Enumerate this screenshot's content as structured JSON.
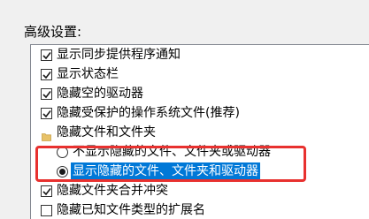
{
  "advanced": {
    "title": "高级设置:",
    "items": [
      {
        "kind": "checkbox",
        "label": "显示同步提供程序通知",
        "checked": true
      },
      {
        "kind": "checkbox",
        "label": "显示状态栏",
        "checked": true
      },
      {
        "kind": "checkbox",
        "label": "隐藏空的驱动器",
        "checked": true
      },
      {
        "kind": "checkbox",
        "label": "隐藏受保护的操作系统文件(推荐)",
        "checked": true
      },
      {
        "kind": "folder",
        "label": "隐藏文件和文件夹",
        "icon": "folder-icon"
      },
      {
        "kind": "radio",
        "label": "不显示隐藏的文件、文件夹或驱动器",
        "checked": false
      },
      {
        "kind": "radio",
        "label": "显示隐藏的文件、文件夹和驱动器",
        "checked": true,
        "selected": true
      },
      {
        "kind": "checkbox",
        "label": "隐藏文件夹合并冲突",
        "checked": true
      },
      {
        "kind": "checkbox",
        "label": "隐藏已知文件类型的扩展名",
        "checked": false
      }
    ]
  },
  "colors": {
    "selection": "#0078d7",
    "highlight_box": "#e8312f",
    "window_bg": "#f0f0f0"
  }
}
